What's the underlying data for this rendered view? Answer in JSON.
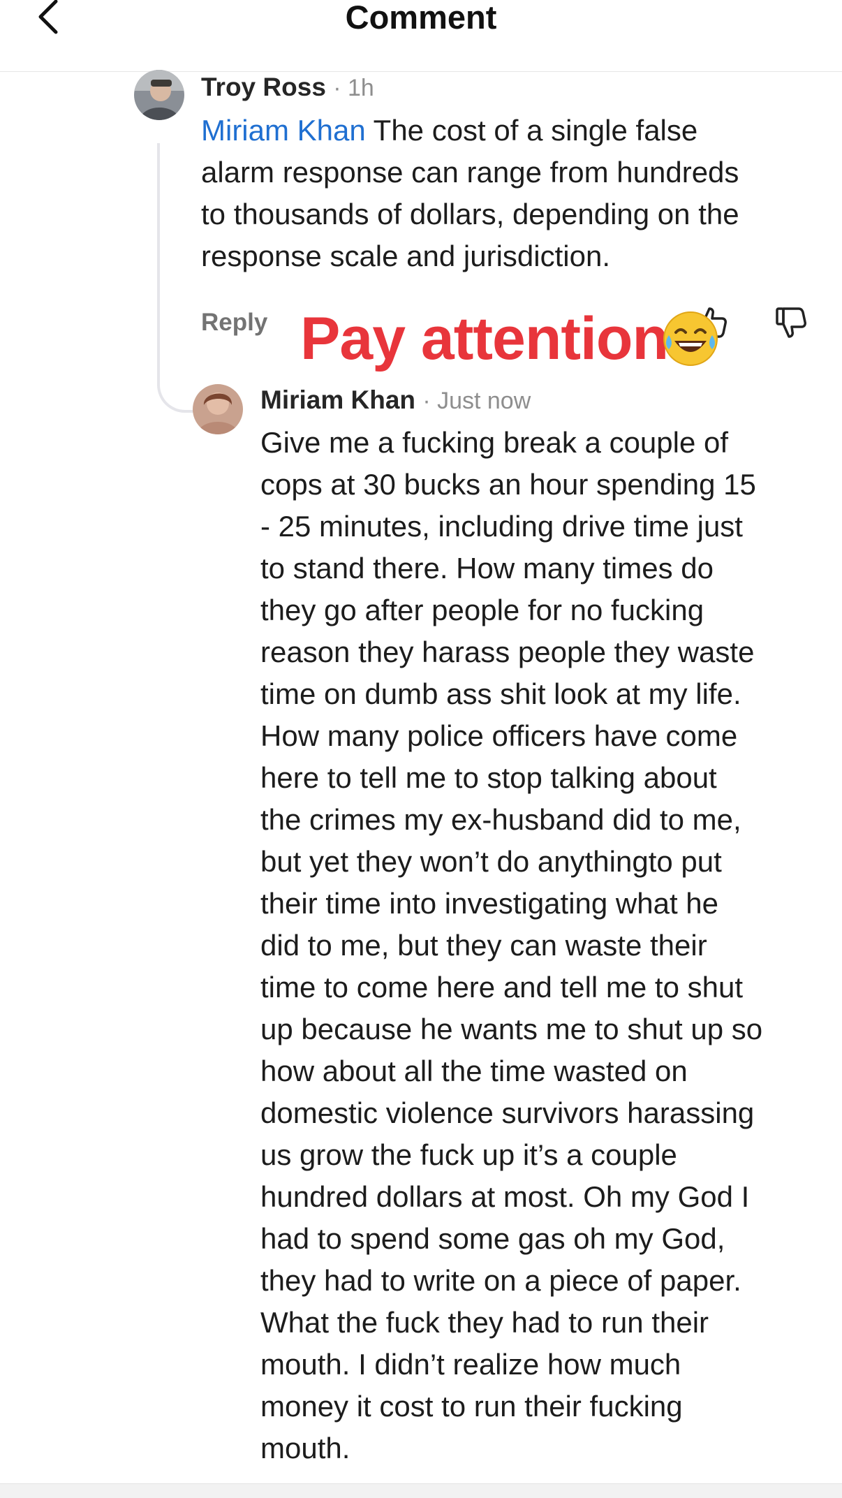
{
  "header": {
    "title": "Comment",
    "back_icon": "chevron-left-icon"
  },
  "comments": [
    {
      "author": "Troy Ross",
      "time": "· 1h",
      "mention": "Miriam Khan",
      "lines": [
        " The cost of a single false",
        "alarm response can range from hundreds",
        "to thousands of dollars, depending on the",
        "response scale and jurisdiction."
      ],
      "reply_label": "Reply",
      "like_icon": "thumbs-up-icon",
      "dislike_icon": "thumbs-down-icon"
    },
    {
      "author": "Miriam Khan",
      "time": "· Just now",
      "lines": [
        "Give me a fucking break a couple of",
        "cops at 30 bucks an hour spending 15",
        "- 25 minutes, including drive time just",
        "to stand there. How many times do",
        "they go after people for no fucking",
        "reason they harass people they waste",
        "time on dumb ass shit look at my life.",
        "How many police officers have come",
        "here to tell me to stop talking about",
        "the crimes my ex-husband did to me,",
        "but yet they won’t do anythingto put",
        "their time into investigating what he",
        "did to me, but they can waste their",
        "time to come here and tell me to shut",
        "up because he wants me to shut up so",
        "how about all the time wasted on",
        "domestic violence survivors harassing",
        "us grow the fuck up it’s a couple",
        "hundred dollars at most. Oh my God I",
        "had to spend some gas oh my God,",
        "they had to write on a piece of paper.",
        "What the fuck they had to run their",
        "mouth. I didn’t realize how much",
        "money it cost to run their fucking",
        "mouth."
      ]
    }
  ],
  "overlay": {
    "caption": "Pay attention",
    "emoji": "laughing-tears-emoji",
    "caption_color": "#e8353b"
  },
  "colors": {
    "mention": "#1f6fd1",
    "meta": "#8e8e8e"
  }
}
